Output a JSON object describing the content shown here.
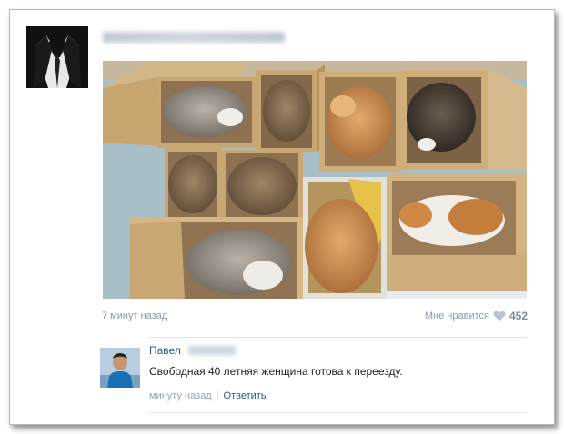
{
  "post": {
    "time": "7 минут назад",
    "like_label": "Мне нравится",
    "like_count": "452",
    "photo_subject": "cats sleeping in cardboard boxes",
    "like_icon": "heart-icon"
  },
  "comment": {
    "author_first_name": "Павел",
    "text": "Свободная 40 летняя женщина готова к переезду.",
    "time": "минуту назад",
    "separator": "|",
    "reply_label": "Ответить"
  },
  "colors": {
    "link": "#2b5a8c",
    "meta": "#8a98a8",
    "like_count": "#7d8ea3"
  }
}
